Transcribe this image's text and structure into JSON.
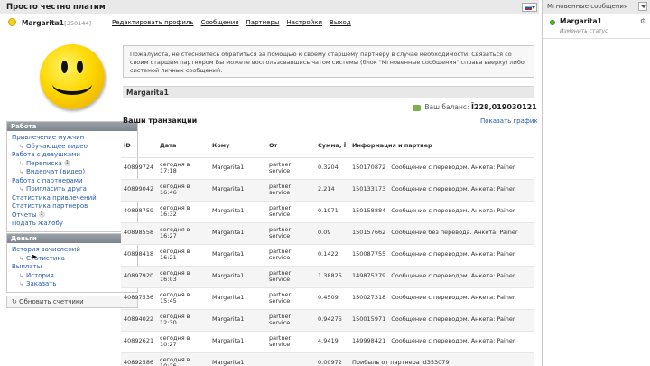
{
  "header": {
    "site_title": "Просто честно платим"
  },
  "user": {
    "name": "Margarita1",
    "id_text": "ID: [350144]"
  },
  "nav": [
    "Редактировать профиль",
    "Сообщения",
    "Партнеры",
    "Настройки",
    "Выход"
  ],
  "sidebar": {
    "work": {
      "title": "Работа",
      "items": [
        {
          "label": "Привлечение мужчин",
          "sub": false
        },
        {
          "label": "Обучающее видео",
          "sub": true
        },
        {
          "label": "Работа с девушками",
          "sub": false
        },
        {
          "label": "Переписка",
          "sub": true,
          "badge": "1"
        },
        {
          "label": "Видеочат (видео)",
          "sub": true
        },
        {
          "label": "Работа с партнерами",
          "sub": false
        },
        {
          "label": "Пригласить друга",
          "sub": true
        },
        {
          "label": "Статистика привлечений",
          "sub": false
        },
        {
          "label": "Статистика партнеров",
          "sub": false
        },
        {
          "label": "Отчеты",
          "sub": false,
          "badge": "1"
        },
        {
          "label": "Подать жалобу",
          "sub": false
        }
      ]
    },
    "money": {
      "title": "Деньги",
      "items": [
        {
          "label": "История зачислений",
          "sub": false
        },
        {
          "label": "Статистика",
          "sub": true
        },
        {
          "label": "Выплаты",
          "sub": false
        },
        {
          "label": "История",
          "sub": true
        },
        {
          "label": "Заказать",
          "sub": true
        }
      ]
    },
    "refresh_label": "Обновить счетчики"
  },
  "main": {
    "notice": "Пожалуйста, не стесняйтесь обратиться за помощью к своему старшему партнеру в случае необходимости. Связаться со своим старшим партнером Вы можете воспользовавшись чатом системы (блок \"Мгновенные сообщения\" справа вверху) либо системой личных сообщений.",
    "crumb": "Margarita1",
    "balance_label": "Ваш баланс:",
    "balance_value": "Ī228,019030121",
    "tx_title": "Ваши транзакции",
    "graph_link": "Показать график",
    "columns": [
      "ID",
      "Дата",
      "Кому",
      "От",
      "Сумма, Ī",
      "Информация и партнер"
    ],
    "rows": [
      {
        "id": "40899724",
        "date": "сегодня в 17:18",
        "to": "Margarita1",
        "from": "partner service",
        "sum": "0.3204",
        "info_id": "150170872",
        "info": "Сообщение с переводом. Анкета: Painer"
      },
      {
        "id": "40899042",
        "date": "сегодня в 16:46",
        "to": "Margarita1",
        "from": "partner service",
        "sum": "2.214",
        "info_id": "150133173",
        "info": "Сообщение с переводом. Анкета: Painer"
      },
      {
        "id": "40898759",
        "date": "сегодня в 16:32",
        "to": "Margarita1",
        "from": "partner service",
        "sum": "0.1971",
        "info_id": "150158884",
        "info": "Сообщение с переводом. Анкета: Painer"
      },
      {
        "id": "40898558",
        "date": "сегодня в 16:27",
        "to": "Margarita1",
        "from": "partner service",
        "sum": "0.09",
        "info_id": "150157662",
        "info": "Сообщение без перевода. Анкета: Painer"
      },
      {
        "id": "40898418",
        "date": "сегодня в 16:21",
        "to": "Margarita1",
        "from": "partner service",
        "sum": "0.1422",
        "info_id": "150087755",
        "info": "Сообщение с переводом. Анкета: Painer"
      },
      {
        "id": "40897920",
        "date": "сегодня в 16:03",
        "to": "Margarita1",
        "from": "partner service",
        "sum": "1.38825",
        "info_id": "149875279",
        "info": "Сообщение с переводом. Анкета: Painer"
      },
      {
        "id": "40897536",
        "date": "сегодня в 15:45",
        "to": "Margarita1",
        "from": "partner service",
        "sum": "0.4509",
        "info_id": "150027318",
        "info": "Сообщение с переводом. Анкета: Painer"
      },
      {
        "id": "40894022",
        "date": "сегодня в 12:30",
        "to": "Margarita1",
        "from": "partner service",
        "sum": "0.94275",
        "info_id": "150015971",
        "info": "Сообщение с переводом. Анкета: Painer"
      },
      {
        "id": "40892621",
        "date": "сегодня в 10:27",
        "to": "Margarita1",
        "from": "partner service",
        "sum": "4.9419",
        "info_id": "149998421",
        "info": "Сообщение с переводом. Анкета: Painer"
      },
      {
        "id": "40892586",
        "date": "сегодня в 10:26",
        "to": "Margarita1",
        "from": "",
        "sum": "0.00972",
        "info_id": "",
        "info": "Прибыль от партнера id353079"
      }
    ]
  },
  "messenger": {
    "title": "Мгновенные сообщения",
    "user": "Margarita1",
    "status": "Изменить статус"
  }
}
